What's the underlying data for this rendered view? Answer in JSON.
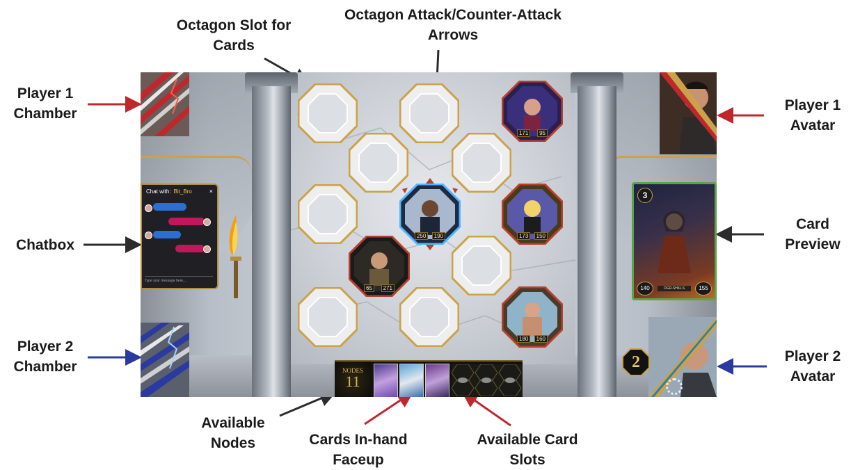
{
  "annotations": {
    "octagon_slot": "Octagon Slot for\nCards",
    "octagon_arrows": "Octagon Attack/Counter-Attack\nArrows",
    "player1_chamber": "Player 1\nChamber",
    "player1_avatar": "Player 1\nAvatar",
    "chatbox": "Chatbox",
    "card_preview": "Card\nPreview",
    "player2_chamber": "Player 2\nChamber",
    "player2_avatar": "Player 2\nAvatar",
    "available_nodes": "Available\nNodes",
    "cards_in_hand": "Cards In-hand\nFaceup",
    "available_card_slots": "Available Card\nSlots"
  },
  "chat": {
    "title": "Chat with:",
    "username": "Bit_Bro",
    "close": "×",
    "placeholder": "Type your message here..."
  },
  "board_cards": [
    {
      "id": "p2-top",
      "attack": "171",
      "health": "95"
    },
    {
      "id": "center",
      "attack": "250",
      "health": "190"
    },
    {
      "id": "right-mid",
      "attack": "173",
      "health": "150"
    },
    {
      "id": "left-mid",
      "attack": "65",
      "health": "271"
    },
    {
      "id": "right-bottom",
      "attack": "180",
      "health": "160"
    }
  ],
  "preview": {
    "cost": "3",
    "attack": "140",
    "health": "155",
    "name": "OGR-SHILLS"
  },
  "hand": {
    "nodes_label": "NODES",
    "nodes_count": "11"
  },
  "turn_number": "2",
  "colors": {
    "player1": "#c0272d",
    "player2": "#2a3a9e",
    "gold": "#c9a24a"
  }
}
